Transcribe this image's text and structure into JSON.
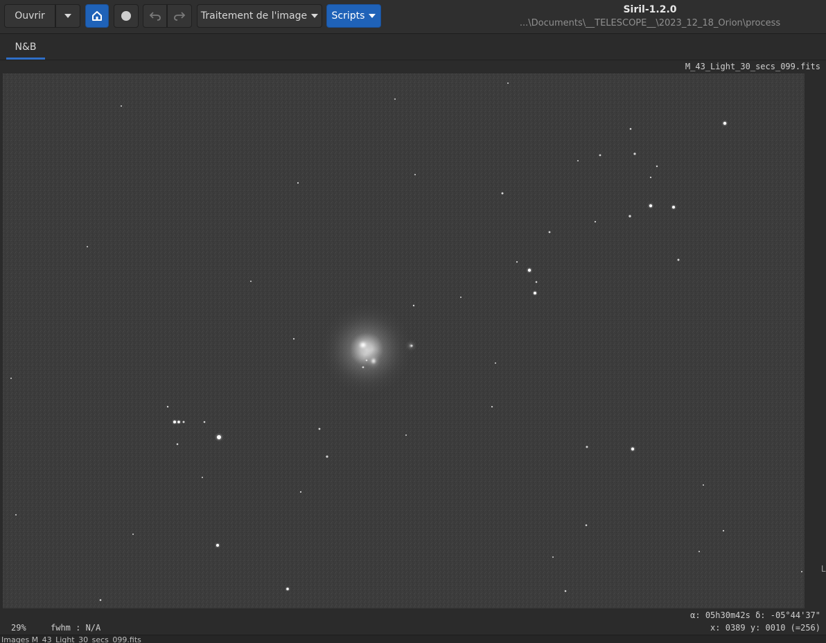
{
  "toolbar": {
    "open_label": "Ouvrir",
    "open_menu_icon": "chevron-down-icon",
    "home_icon": "home-icon",
    "record_icon": "circle-icon",
    "undo_icon": "undo-icon",
    "redo_icon": "redo-icon",
    "processing_label": "Traitement de l'image",
    "scripts_label": "Scripts"
  },
  "window": {
    "title": "Siril-1.2.0",
    "path": "...\\Documents\\__TELESCOPE__\\2023_12_18_Orion\\process"
  },
  "tabs": [
    {
      "label": "N&B",
      "active": true
    }
  ],
  "image": {
    "filename": "M_43_Light_30_secs_099.fits"
  },
  "side_marker": "L",
  "status": {
    "zoom": "29%",
    "fwhm": "fwhm : N/A",
    "radec": "α: 05h30m42s δ: -05°44'37\"",
    "xy": "x: 0389 y: 0010 (=256)"
  },
  "bottom_text": "Images    M_43_Light_30_secs_099.fits",
  "colors": {
    "accent": "#1f62b8",
    "background": "#2b2b2b",
    "sky": "#3d3d3d"
  }
}
